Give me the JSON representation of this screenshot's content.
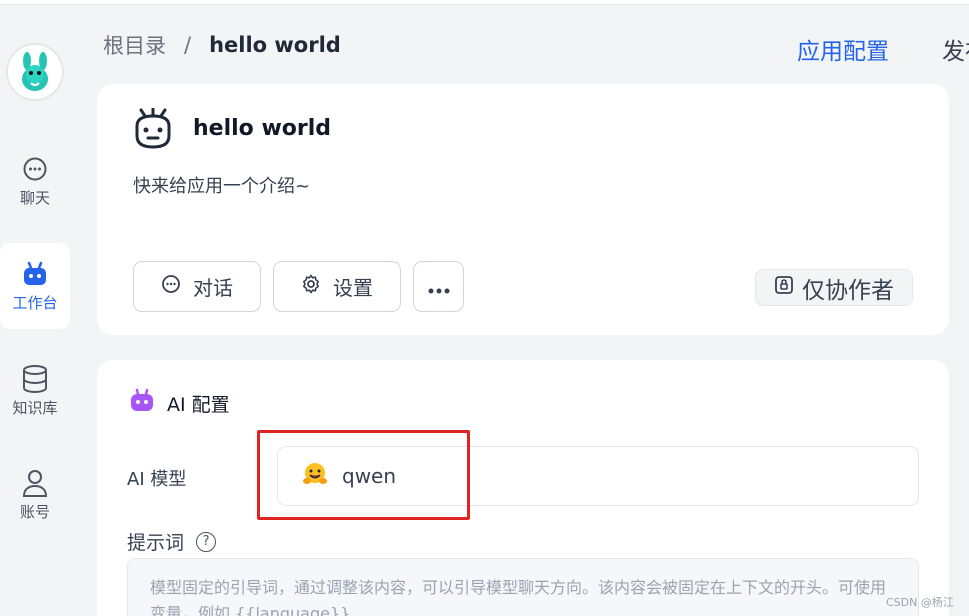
{
  "sidebar": {
    "items": [
      {
        "label": "聊天",
        "icon": "chat-bubble-icon"
      },
      {
        "label": "工作台",
        "icon": "robot-icon"
      },
      {
        "label": "知识库",
        "icon": "database-icon"
      },
      {
        "label": "账号",
        "icon": "user-icon"
      }
    ]
  },
  "breadcrumb": {
    "root": "根目录",
    "separator": "/",
    "current": "hello world"
  },
  "header": {
    "app_config": "应用配置",
    "publish": "发布"
  },
  "app": {
    "name": "hello world",
    "intro": "快来给应用一个介绍~",
    "chat_label": "对话",
    "settings_label": "设置",
    "permission": "仅协作者"
  },
  "ai": {
    "section_title": "AI 配置",
    "model_label": "AI 模型",
    "model_value": "qwen",
    "prompt_label": "提示词",
    "prompt_placeholder": "模型固定的引导词，通过调整该内容，可以引导模型聊天方向。该内容会被固定在上下文的开头。可使用变量，例如 {{language}}"
  },
  "watermark": "CSDN @杨江",
  "colors": {
    "accent": "#2563eb",
    "highlight": "#e02424"
  }
}
